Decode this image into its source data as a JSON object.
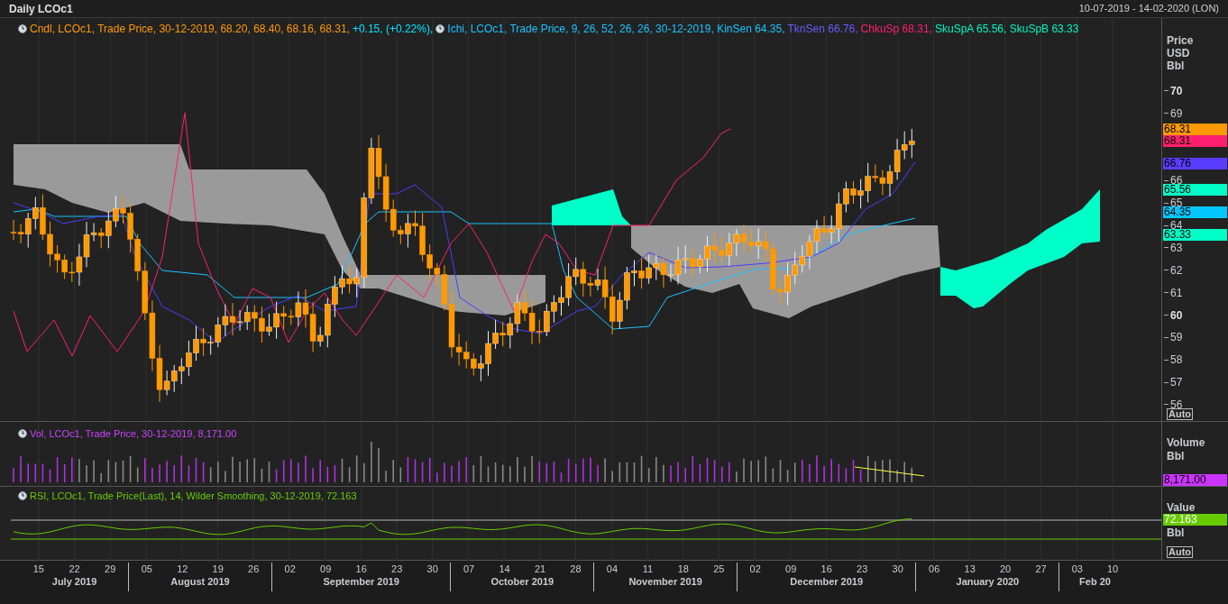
{
  "window": {
    "title": "Daily LCOc1",
    "date_range": "10-07-2019 - 14-02-2020 (LON)"
  },
  "price_pane": {
    "legends": [
      {
        "segments": [
          {
            "text": "Cndl, LCOc1, Trade Price,  30-12-2019, 68.20, 68.40, 68.16, 68.31,",
            "color": "#ff9900"
          },
          {
            "text": "+0.15, (+0.22%),",
            "color": "#00e5ff"
          }
        ]
      },
      {
        "segments": [
          {
            "text": "Ichi, LCOc1, Trade Price,  9, 26, 52, 26, 26,  30-12-2019, KinSen 64.35,",
            "color": "#19c3ff"
          },
          {
            "text": "TknSen 66.76,",
            "color": "#6a5cff"
          },
          {
            "text": "ChkuSp 68.31,",
            "color": "#ff1f6e"
          },
          {
            "text": "SkuSpA 65.56, SkuSpB 63.33",
            "color": "#00f5c0"
          }
        ]
      }
    ],
    "axis": {
      "title": [
        "Price",
        "USD",
        "Bbl"
      ],
      "ticks": [
        {
          "label": "70",
          "bold": true
        },
        {
          "label": "69",
          "bold": false
        },
        {
          "label": "66",
          "bold": false
        },
        {
          "label": "65",
          "bold": false
        },
        {
          "label": "64",
          "bold": false
        },
        {
          "label": "63",
          "bold": false
        },
        {
          "label": "62",
          "bold": false
        },
        {
          "label": "61",
          "bold": false
        },
        {
          "label": "60",
          "bold": true
        },
        {
          "label": "59",
          "bold": false
        },
        {
          "label": "58",
          "bold": false
        },
        {
          "label": "57",
          "bold": false
        },
        {
          "label": "56",
          "bold": false
        }
      ],
      "value_tags": [
        {
          "label": "68.31",
          "color": "#ff9900"
        },
        {
          "label": "68.31",
          "color": "#ff1f6e"
        },
        {
          "label": "66.76",
          "color": "#5a3cff"
        },
        {
          "label": "65.56",
          "color": "#00ffc8"
        },
        {
          "label": "64.35",
          "color": "#00c8ff"
        },
        {
          "label": "63.33",
          "color": "#00ffc8"
        }
      ],
      "auto_button": "Auto"
    }
  },
  "volume_pane": {
    "legend": {
      "text": "Vol, LCOc1, Trade Price,  30-12-2019, 8,171.00",
      "color": "#cc44ff"
    },
    "axis": {
      "title": [
        "Volume",
        "Bbl"
      ],
      "value_tag": {
        "label": "8,171.00",
        "color": "#cc33ff"
      }
    }
  },
  "rsi_pane": {
    "legend": {
      "text": "RSI, LCOc1, Trade Price(Last),  14, Wilder Smoothing,  30-12-2019, 72.163",
      "color": "#66cc00"
    },
    "axis": {
      "title": [
        "Value",
        "Bbl"
      ],
      "value_tag": {
        "label": "72.163",
        "color": "#66cc00"
      },
      "auto_button": "Auto"
    }
  },
  "date_axis": [
    {
      "month": "July 2019",
      "days": [
        "15",
        "22",
        "29"
      ]
    },
    {
      "month": "August 2019",
      "days": [
        "05",
        "12",
        "19",
        "26"
      ]
    },
    {
      "month": "September 2019",
      "days": [
        "02",
        "09",
        "16",
        "23",
        "30"
      ]
    },
    {
      "month": "October 2019",
      "days": [
        "07",
        "14",
        "21",
        "28"
      ]
    },
    {
      "month": "November 2019",
      "days": [
        "04",
        "11",
        "18",
        "25"
      ]
    },
    {
      "month": "December 2019",
      "days": [
        "02",
        "09",
        "16",
        "23",
        "30"
      ]
    },
    {
      "month": "January 2020",
      "days": [
        "06",
        "13",
        "20",
        "27"
      ]
    },
    {
      "month": "Feb 20",
      "days": [
        "03",
        "10"
      ]
    }
  ]
}
